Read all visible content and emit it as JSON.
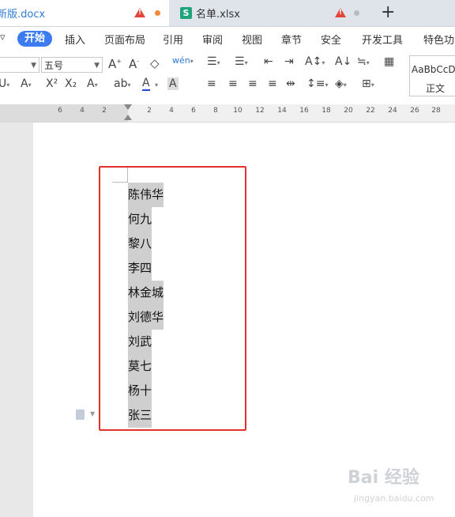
{
  "tabs": [
    {
      "title": "新版.docx",
      "active": true
    },
    {
      "title": "名单.xlsx",
      "active": false,
      "icon_text": "S"
    }
  ],
  "new_tab_symbol": "+",
  "menu": [
    "开始",
    "插入",
    "页面布局",
    "引用",
    "审阅",
    "视图",
    "章节",
    "安全",
    "开发工具",
    "特色功能"
  ],
  "menu_active": "开始",
  "toolbar": {
    "font_name": "",
    "font_size": "五号",
    "style_preview": "AaBbCcDd",
    "style_name": "正文"
  },
  "ruler": {
    "marks_left": [
      "6",
      "4",
      "2"
    ],
    "marks_right": [
      "2",
      "4",
      "6",
      "8",
      "10",
      "12",
      "14",
      "16",
      "18",
      "20",
      "22",
      "24",
      "26",
      "28"
    ]
  },
  "document": {
    "names": [
      "陈伟华",
      "何九",
      "黎八",
      "李四",
      "林金城",
      "刘德华",
      "刘武",
      "莫七",
      "杨十",
      "张三"
    ]
  },
  "colors": {
    "accent": "#3d7cf0",
    "highlight_border": "#e3322e",
    "selection": "#cfcfcf",
    "xlsx_icon": "#1fa37b"
  },
  "watermark": {
    "main": "Bai 经验",
    "sub": "jingyan.baidu.com"
  }
}
